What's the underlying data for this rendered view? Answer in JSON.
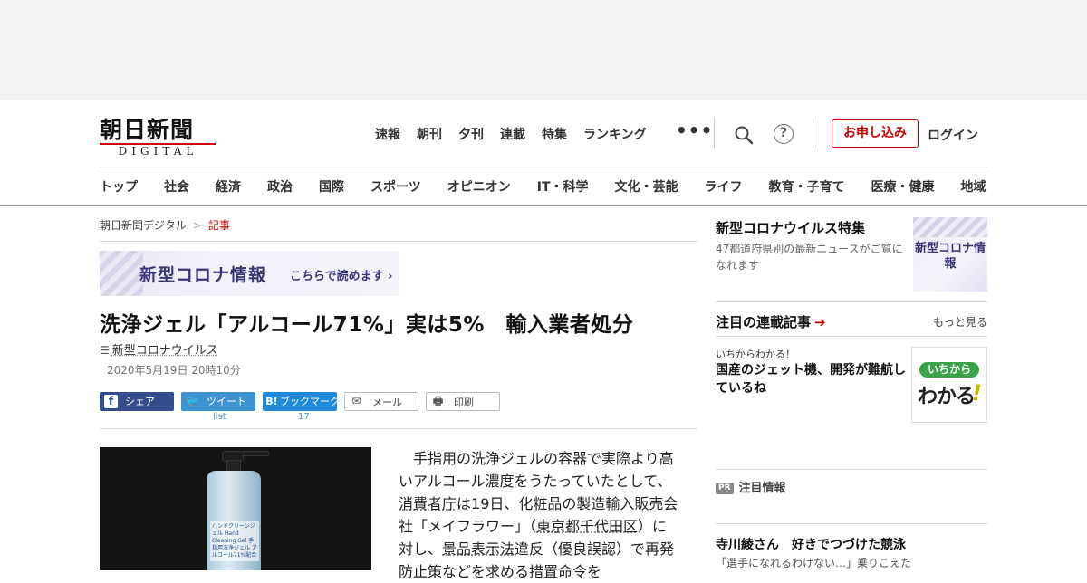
{
  "header": {
    "logo_main": "朝日新聞",
    "logo_sub": "DIGITAL",
    "top_nav": [
      "速報",
      "朝刊",
      "夕刊",
      "連載",
      "特集",
      "ランキング"
    ],
    "more_label": "•••",
    "help_label": "?",
    "subscribe_label": "お申し込み",
    "login_label": "ログイン",
    "categories": [
      "トップ",
      "社会",
      "経済",
      "政治",
      "国際",
      "スポーツ",
      "オピニオン",
      "IT・科学",
      "文化・芸能",
      "ライフ",
      "教育・子育て",
      "医療・健康",
      "地域"
    ]
  },
  "breadcrumb": {
    "home": "朝日新聞デジタル",
    "separator": ">",
    "current": "記事"
  },
  "banner": {
    "title": "新型コロナ情報",
    "link": "こちらで読めます ›"
  },
  "article": {
    "headline": "洗浄ジェル「アルコール71%」実は5%　輸入業者処分",
    "topic_icon": "☰",
    "topic": "新型コロナウイルス",
    "timestamp": "2020年5月19日 20時10分",
    "share": {
      "facebook_icon": "f",
      "facebook": "シェア",
      "twitter_icon": "🐦",
      "twitter": "ツイート",
      "twitter_count": "list",
      "hatena_icon": "B!",
      "hatena": "ブックマーク",
      "hatena_count": "17",
      "mail_icon": "✉",
      "mail": "メール",
      "print_icon": "🖶",
      "print": "印刷"
    },
    "photo_label": "ハンドクリーンジェル Hand Cleaning Gel 手指用洗浄ジェル アルコール71%配合",
    "body": {
      "p1_a": "手指用の洗浄ジェルの容器で実際より高いアルコール濃度をうたっていたとして、",
      "link1": "消費者庁",
      "p1_b": "は19日、化粧品の製造輸入販売会社「メイフラワー」（",
      "link2": "東京都千代田区",
      "p1_c": "）に対し、",
      "link3": "景品表示法",
      "p1_d": "違反（優良誤認）で再発防止策などを求める措置命令を"
    }
  },
  "sidebar": {
    "feature_title": "新型コロナウイルス特集",
    "feature_desc": "47都道府県別の最新ニュースがご覧になれます",
    "feature_thumb": "新型コロナ情報",
    "series_title": "注目の連載記事",
    "series_arrow": "➔",
    "series_more": "もっと見る",
    "series_kicker": "いちからわかる！",
    "series_headline": "国産のジェット機、開発が難航しているね",
    "series_thumb_pill": "いちから",
    "series_thumb_big": "わかる",
    "series_thumb_mark": "!",
    "pr_badge": "PR",
    "pr_label": "注目情報",
    "pr_headline": "寺川綾さん　好きでつづけた競泳",
    "pr_sub": "「選手になれるわけない…」乗りこえた"
  }
}
